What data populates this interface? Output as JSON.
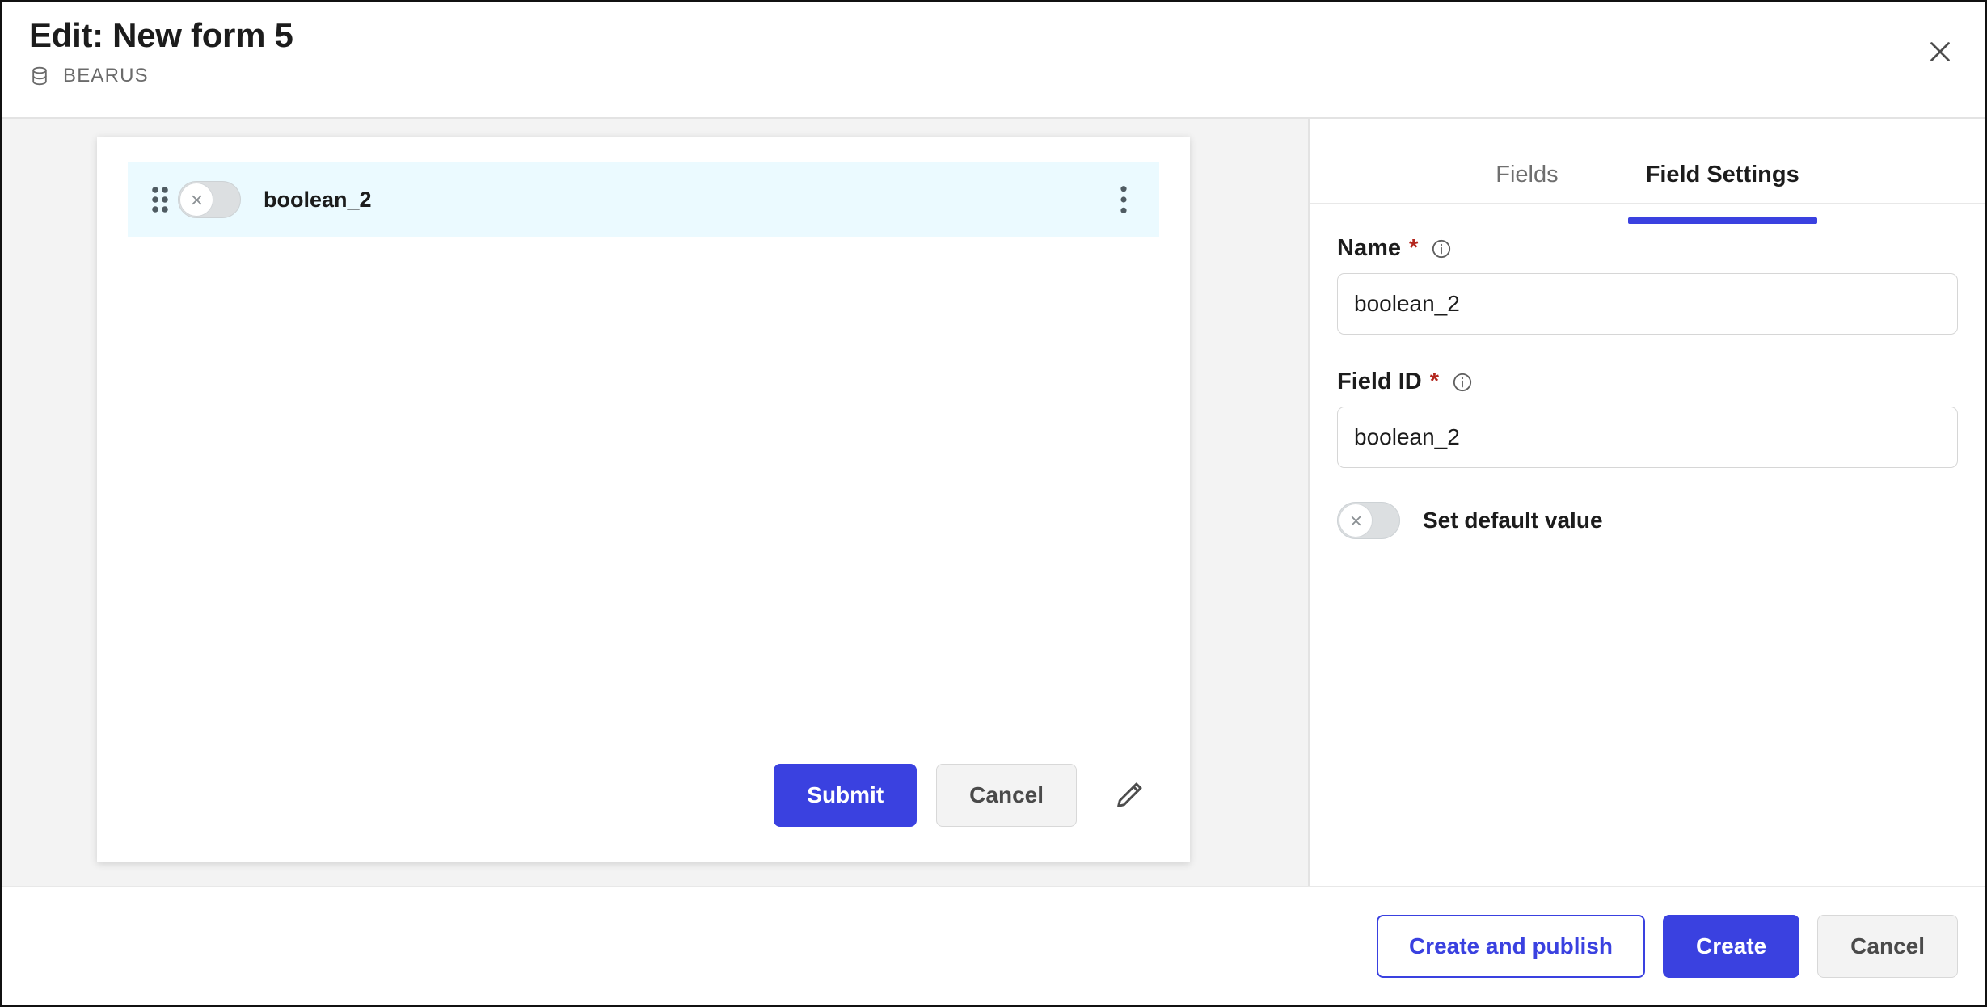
{
  "header": {
    "title": "Edit: New form 5",
    "subtitle": "BEARUS",
    "db_icon": "database-icon",
    "close_icon": "close-icon"
  },
  "canvas": {
    "field_row": {
      "drag_icon": "drag-handle-icon",
      "toggle_state": "off",
      "toggle_glyph": "x",
      "label": "boolean_2",
      "menu_icon": "more-vertical-icon"
    },
    "actions": {
      "submit_label": "Submit",
      "cancel_label": "Cancel",
      "edit_icon": "pencil-icon"
    }
  },
  "panel": {
    "tabs": [
      {
        "label": "Fields",
        "active": false
      },
      {
        "label": "Field Settings",
        "active": true
      }
    ],
    "name_field": {
      "label": "Name",
      "required_mark": "*",
      "info_icon": "info-icon",
      "value": "boolean_2",
      "placeholder": "Name"
    },
    "field_id_field": {
      "label": "Field ID",
      "required_mark": "*",
      "info_icon": "info-icon",
      "value": "boolean_2",
      "placeholder": "Field ID"
    },
    "default_toggle": {
      "label": "Set default value",
      "state": "off",
      "glyph": "x"
    }
  },
  "footer": {
    "create_publish_label": "Create and publish",
    "create_label": "Create",
    "cancel_label": "Cancel"
  },
  "colors": {
    "accent_blue": "#3a41e0",
    "required_red": "#b3261e",
    "row_highlight": "#ebfaff",
    "canvas_bg": "#f3f3f3"
  }
}
